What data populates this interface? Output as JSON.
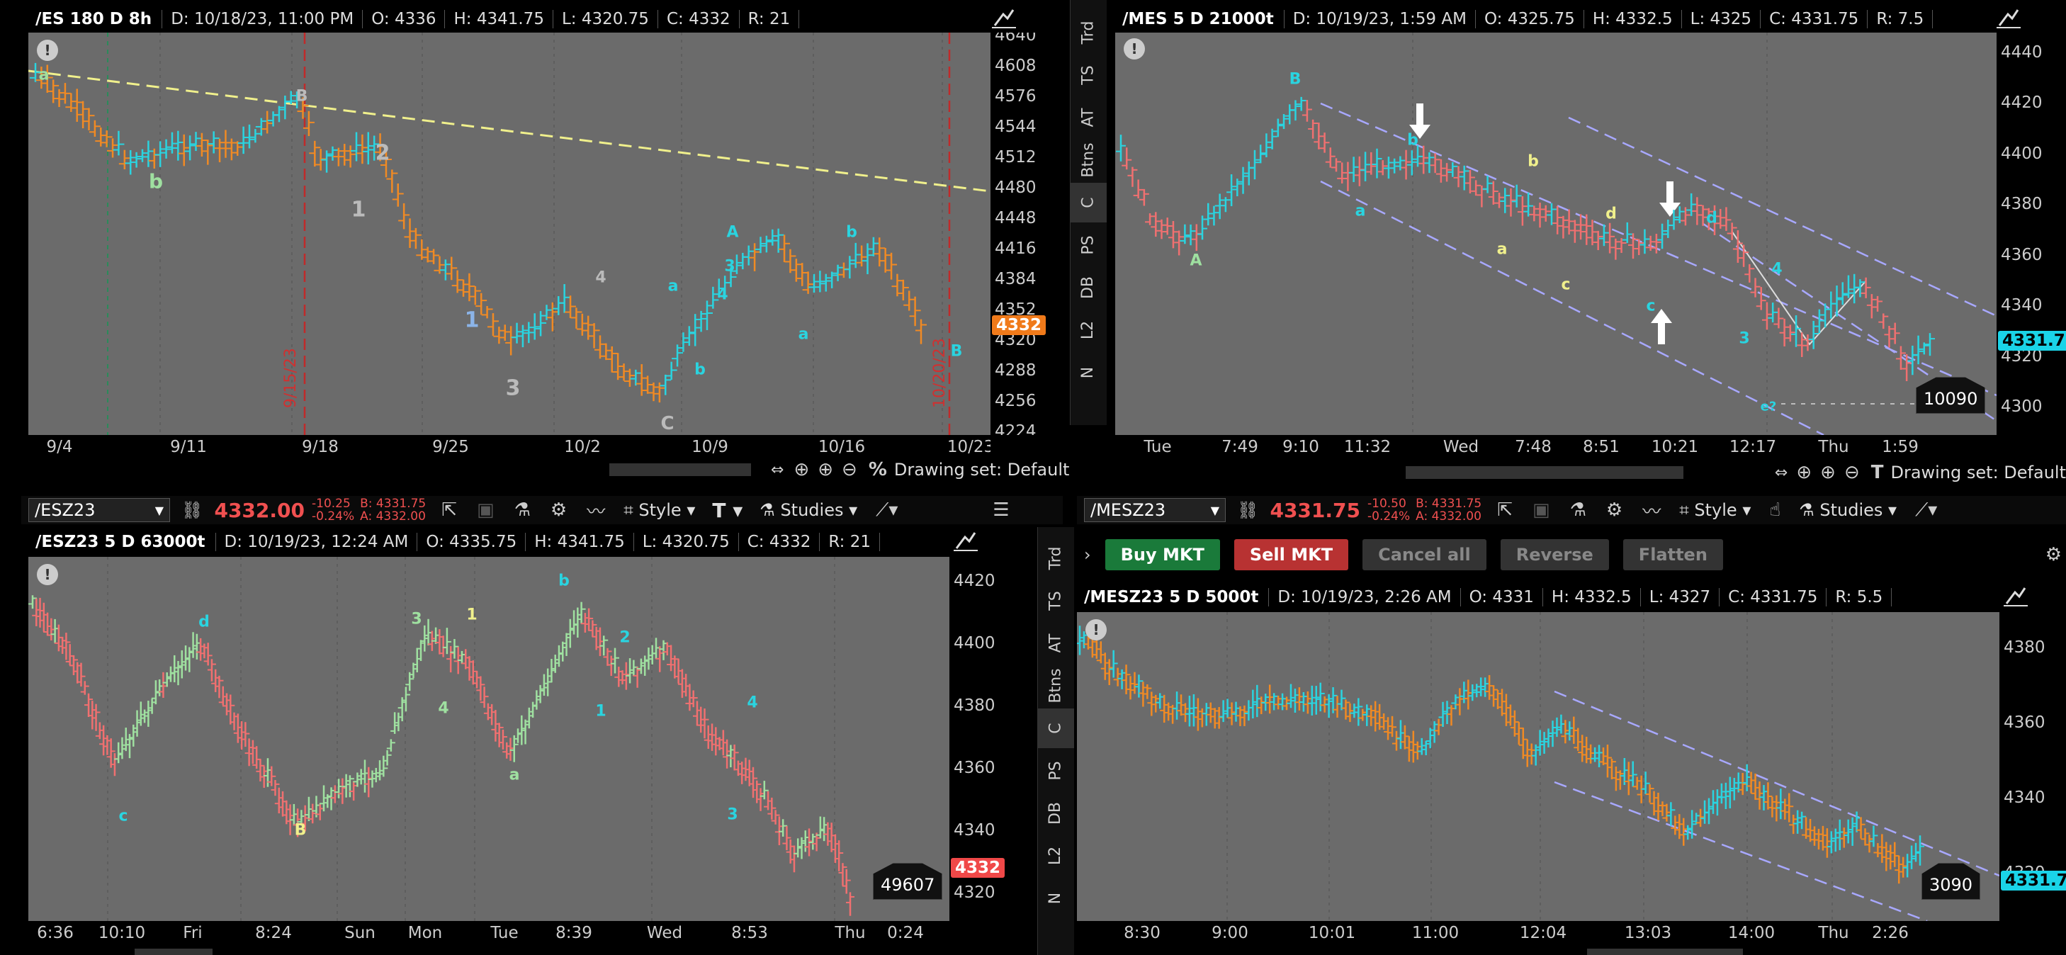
{
  "p1": {
    "symbol": "/ES 180 D 8h",
    "date": "D: 10/18/23, 11:00 PM",
    "open": "O: 4336",
    "high": "H: 4341.75",
    "low": "L: 4320.75",
    "close": "C: 4332",
    "range": "R: 21",
    "yticks": [
      "4640",
      "4608",
      "4576",
      "4544",
      "4512",
      "4480",
      "4448",
      "4416",
      "4384",
      "4352",
      "4320",
      "4288",
      "4256",
      "4224"
    ],
    "price_tag": "4332",
    "xticks": [
      "9/4",
      "9/11",
      "9/18",
      "9/25",
      "10/2",
      "10/9",
      "10/16",
      "10/23"
    ],
    "vline1": "9/15/23",
    "vline2": "10/20/23",
    "labels": {
      "a": "a",
      "b": "b",
      "B": "B",
      "two": "2",
      "one": "1",
      "one2": "1",
      "three": "3",
      "four": "4",
      "C": "C",
      "a2": "a",
      "b2": "b",
      "A": "A",
      "three2": "3",
      "four2": "4",
      "a3": "a",
      "b3": "b",
      "B2": "B"
    },
    "drawing_set": "Drawing set: Default"
  },
  "p2": {
    "symbol": "/MES 5 D 21000t",
    "date": "D: 10/19/23, 1:59 AM",
    "open": "O: 4325.75",
    "high": "H: 4332.5",
    "low": "L: 4325",
    "close": "C: 4331.75",
    "range": "R: 7.5",
    "yticks": [
      "4440",
      "4420",
      "4400",
      "4380",
      "4360",
      "4340",
      "4320",
      "4300"
    ],
    "price_tag": "4331.75",
    "xticks": [
      "Tue",
      "7:49",
      "9:10",
      "11:32",
      "Wed",
      "7:48",
      "8:51",
      "10:21",
      "12:17",
      "Thu",
      "1:59"
    ],
    "volume": "10090",
    "labels": {
      "B": "B",
      "A": "A",
      "a": "a",
      "b": "b",
      "b2": "b",
      "a2": "a",
      "c": "c",
      "d": "d",
      "c2": "c",
      "d2": "d",
      "four": "4",
      "three": "3",
      "e": "e?"
    },
    "drawing_set": "Drawing set: Default"
  },
  "p3": {
    "toolbar": {
      "symbol": "/ESZ23",
      "price": "4332.00",
      "chg1": "-10.25",
      "chg2": "-0.24%",
      "bid": "B: 4331.75",
      "ask": "A: 4332.00",
      "style": "Style",
      "studies": "Studies"
    },
    "symbol": "/ESZ23 5 D 63000t",
    "date": "D: 10/19/23, 12:24 AM",
    "open": "O: 4335.75",
    "high": "H: 4341.75",
    "low": "L: 4320.75",
    "close": "C: 4332",
    "range": "R: 21",
    "yticks": [
      "4420",
      "4400",
      "4380",
      "4360",
      "4340",
      "4320"
    ],
    "price_tag": "4332",
    "xticks": [
      "6:36",
      "10:10",
      "Fri",
      "8:24",
      "Sun",
      "Mon",
      "Tue",
      "8:39",
      "Wed",
      "8:53",
      "Thu",
      "0:24"
    ],
    "volume": "49607",
    "labels": {
      "c": "c",
      "d": "d",
      "B": "B",
      "three": "3",
      "four": "4",
      "one": "1",
      "a": "a",
      "b": "b",
      "one2": "1",
      "two": "2",
      "four2": "4",
      "three2": "3"
    }
  },
  "p4": {
    "toolbar": {
      "symbol": "/MESZ23",
      "price": "4331.75",
      "chg1": "-10.50",
      "chg2": "-0.24%",
      "bid": "B: 4331.75",
      "ask": "A: 4332.00",
      "style": "Style",
      "studies": "Studies"
    },
    "trade": {
      "buy": "Buy MKT",
      "sell": "Sell MKT",
      "cancel": "Cancel all",
      "reverse": "Reverse",
      "flatten": "Flatten"
    },
    "symbol": "/MESZ23 5 D 5000t",
    "date": "D: 10/19/23, 2:26 AM",
    "open": "O: 4331",
    "high": "H: 4332.5",
    "low": "L: 4327",
    "close": "C: 4331.75",
    "range": "R: 5.5",
    "yticks": [
      "4380",
      "4360",
      "4340",
      "4320"
    ],
    "price_tag": "4331.75",
    "xticks": [
      "8:30",
      "9:00",
      "10:01",
      "11:00",
      "12:04",
      "13:03",
      "14:00",
      "Thu",
      "2:26"
    ],
    "volume": "3090"
  },
  "strip": [
    "Trd",
    "TS",
    "AT",
    "Btns",
    "C",
    "PS",
    "DB",
    "L2",
    "N"
  ],
  "colors": {
    "up": "#2ad4e0",
    "down_orange": "#f08a24",
    "down_red": "#f07070",
    "up_green": "#9fe0a0",
    "plot_bg": "#6b6b6b",
    "channel": "#a8a8ff",
    "trend": "#f0f08c",
    "price_orange": "#f07a1a",
    "price_cyan": "#1ad4e8",
    "price_red": "#f04848"
  }
}
